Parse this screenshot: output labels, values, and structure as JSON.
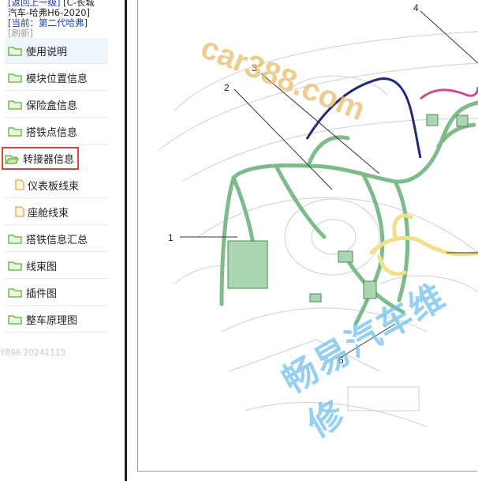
{
  "header": {
    "back_link": "[返回上一级]",
    "breadcrumb_lines": [
      "[C-长城",
      "汽车-哈弗H6-2020]"
    ],
    "current_line": "[当前：第二代哈弗]",
    "refresh": "[刷新]"
  },
  "nav": {
    "items": [
      {
        "label": "使用说明",
        "icon": "folder-icon"
      },
      {
        "label": "模块位置信息",
        "icon": "folder-icon"
      },
      {
        "label": "保险盒信息",
        "icon": "folder-icon"
      },
      {
        "label": "搭铁点信息",
        "icon": "folder-icon"
      },
      {
        "label": "转接器信息",
        "icon": "folder-open-icon",
        "selected": true
      },
      {
        "label": "仪表板线束",
        "icon": "file-icon"
      },
      {
        "label": "座舱线束",
        "icon": "file-icon"
      },
      {
        "label": "搭铁信息汇总",
        "icon": "folder-icon"
      },
      {
        "label": "线束图",
        "icon": "folder-icon"
      },
      {
        "label": "插件图",
        "icon": "folder-icon"
      },
      {
        "label": "整车原理图",
        "icon": "folder-icon"
      }
    ]
  },
  "version": "Y896.20241113",
  "diagram": {
    "callouts": [
      "1",
      "2",
      "3",
      "4",
      "6"
    ],
    "watermark_top": "car388.com",
    "watermark_bottom": "畅易汽车维修"
  },
  "colors": {
    "link": "#1a3bb5",
    "folder": "#5fae3a",
    "file": "#e8a748",
    "selected_border": "#e0413d",
    "harness_green": "#7dbb8a",
    "harness_navy": "#1f2a78",
    "harness_yellow": "#efe08a",
    "harness_pink": "#c64f8a"
  }
}
